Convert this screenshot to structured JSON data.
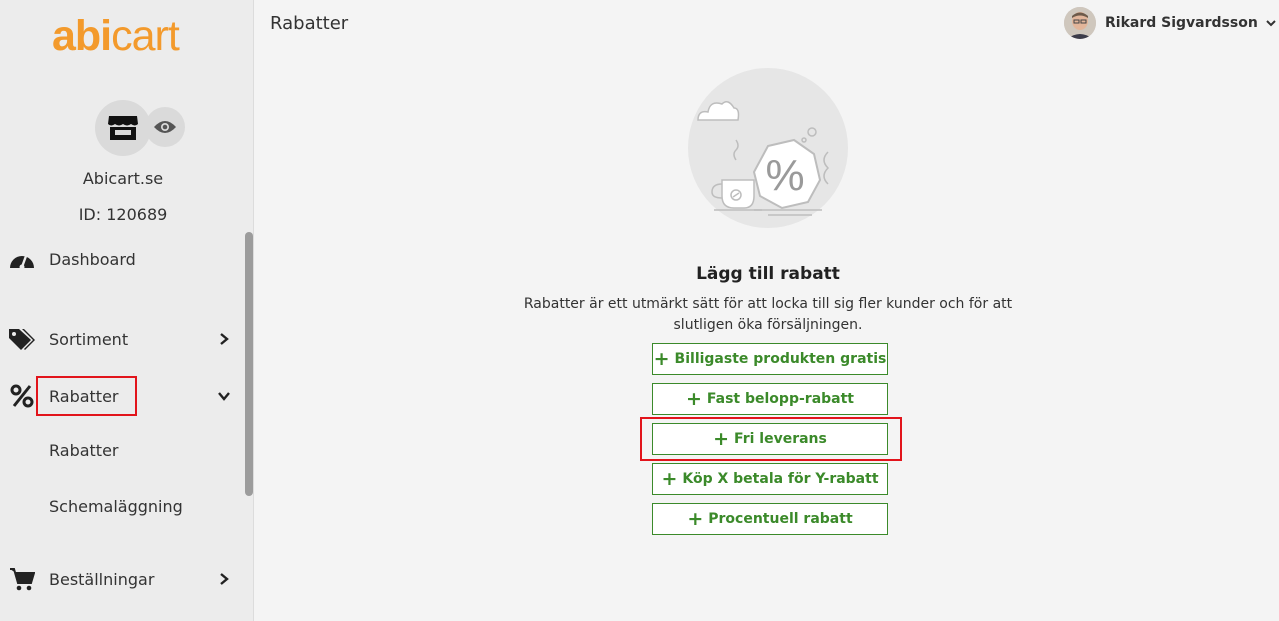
{
  "sidebar": {
    "logo_part1": "abi",
    "logo_part2": "cart",
    "shop_name": "Abicart.se",
    "shop_id": "ID: 120689",
    "items": [
      {
        "label": "Dashboard",
        "icon": "dashboard-icon"
      },
      {
        "label": "Sortiment",
        "icon": "tags-icon"
      },
      {
        "label": "Rabatter",
        "icon": "percent-icon"
      },
      {
        "label": "Beställningar",
        "icon": "cart-icon"
      }
    ],
    "subitems": [
      {
        "label": "Rabatter"
      },
      {
        "label": "Schemaläggning"
      }
    ]
  },
  "header": {
    "title": "Rabatter",
    "user_name": "Rikard Sigvardsson"
  },
  "main": {
    "title": "Lägg till rabatt",
    "description": "Rabatter är ett utmärkt sätt för att locka till sig fler kunder och för att slutligen öka försäljningen.",
    "buttons": [
      {
        "label": "Billigaste produkten gratis"
      },
      {
        "label": "Fast belopp-rabatt"
      },
      {
        "label": "Fri leverans"
      },
      {
        "label": "Köp X betala för Y-rabatt"
      },
      {
        "label": "Procentuell rabatt"
      }
    ],
    "button_prefix": "+"
  },
  "colors": {
    "brand": "#f39a2c",
    "button_green": "#3b8a2a",
    "highlight_red": "#e2141b"
  }
}
